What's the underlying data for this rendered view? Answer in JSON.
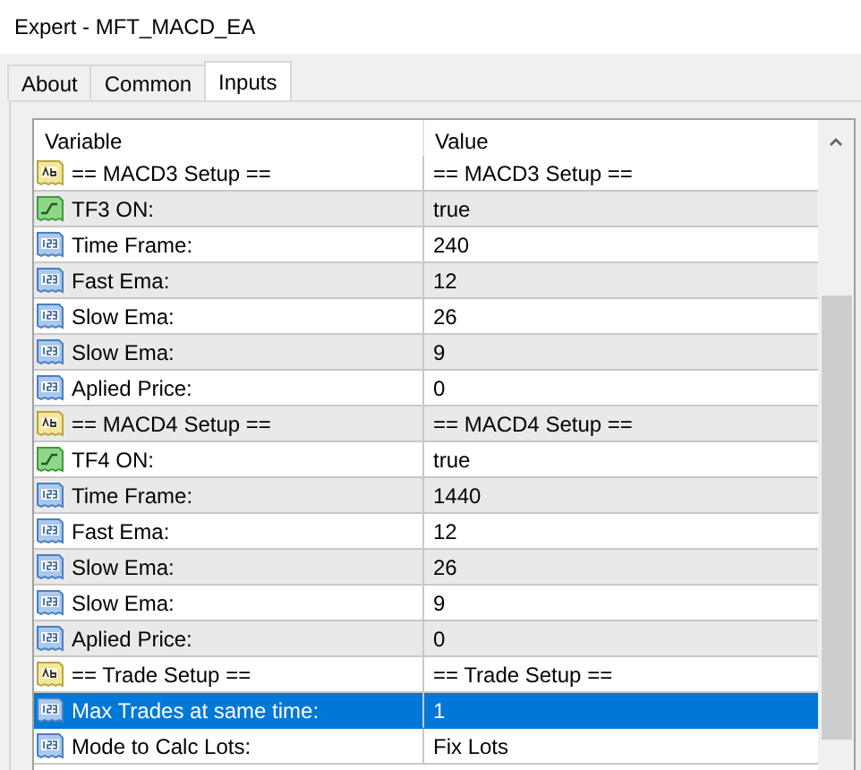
{
  "window": {
    "title": "Expert - MFT_MACD_EA"
  },
  "tabs": [
    {
      "label": "About",
      "selected": false
    },
    {
      "label": "Common",
      "selected": false
    },
    {
      "label": "Inputs",
      "selected": true
    }
  ],
  "table": {
    "columns": [
      "Variable",
      "Value"
    ],
    "rows": [
      {
        "kind": "string",
        "variable": "== MACD3 Setup ==",
        "value": "== MACD3 Setup ==",
        "selected": false
      },
      {
        "kind": "bool",
        "variable": "TF3 ON:",
        "value": "true",
        "selected": false
      },
      {
        "kind": "int",
        "variable": "Time Frame:",
        "value": "240",
        "selected": false
      },
      {
        "kind": "int",
        "variable": "Fast Ema:",
        "value": "12",
        "selected": false
      },
      {
        "kind": "int",
        "variable": "Slow Ema:",
        "value": "26",
        "selected": false
      },
      {
        "kind": "int",
        "variable": "Slow Ema:",
        "value": "9",
        "selected": false
      },
      {
        "kind": "int",
        "variable": "Aplied Price:",
        "value": "0",
        "selected": false
      },
      {
        "kind": "string",
        "variable": "== MACD4 Setup ==",
        "value": "== MACD4 Setup ==",
        "selected": false
      },
      {
        "kind": "bool",
        "variable": "TF4 ON:",
        "value": "true",
        "selected": false
      },
      {
        "kind": "int",
        "variable": "Time Frame:",
        "value": "1440",
        "selected": false
      },
      {
        "kind": "int",
        "variable": "Fast Ema:",
        "value": "12",
        "selected": false
      },
      {
        "kind": "int",
        "variable": "Slow Ema:",
        "value": "26",
        "selected": false
      },
      {
        "kind": "int",
        "variable": "Slow Ema:",
        "value": "9",
        "selected": false
      },
      {
        "kind": "int",
        "variable": "Aplied Price:",
        "value": "0",
        "selected": false
      },
      {
        "kind": "string",
        "variable": "== Trade Setup ==",
        "value": "== Trade Setup ==",
        "selected": false
      },
      {
        "kind": "int",
        "variable": "Max Trades at same time:",
        "value": "1",
        "selected": true
      },
      {
        "kind": "int",
        "variable": "Mode to Calc Lots:",
        "value": "Fix Lots",
        "selected": false
      }
    ]
  }
}
